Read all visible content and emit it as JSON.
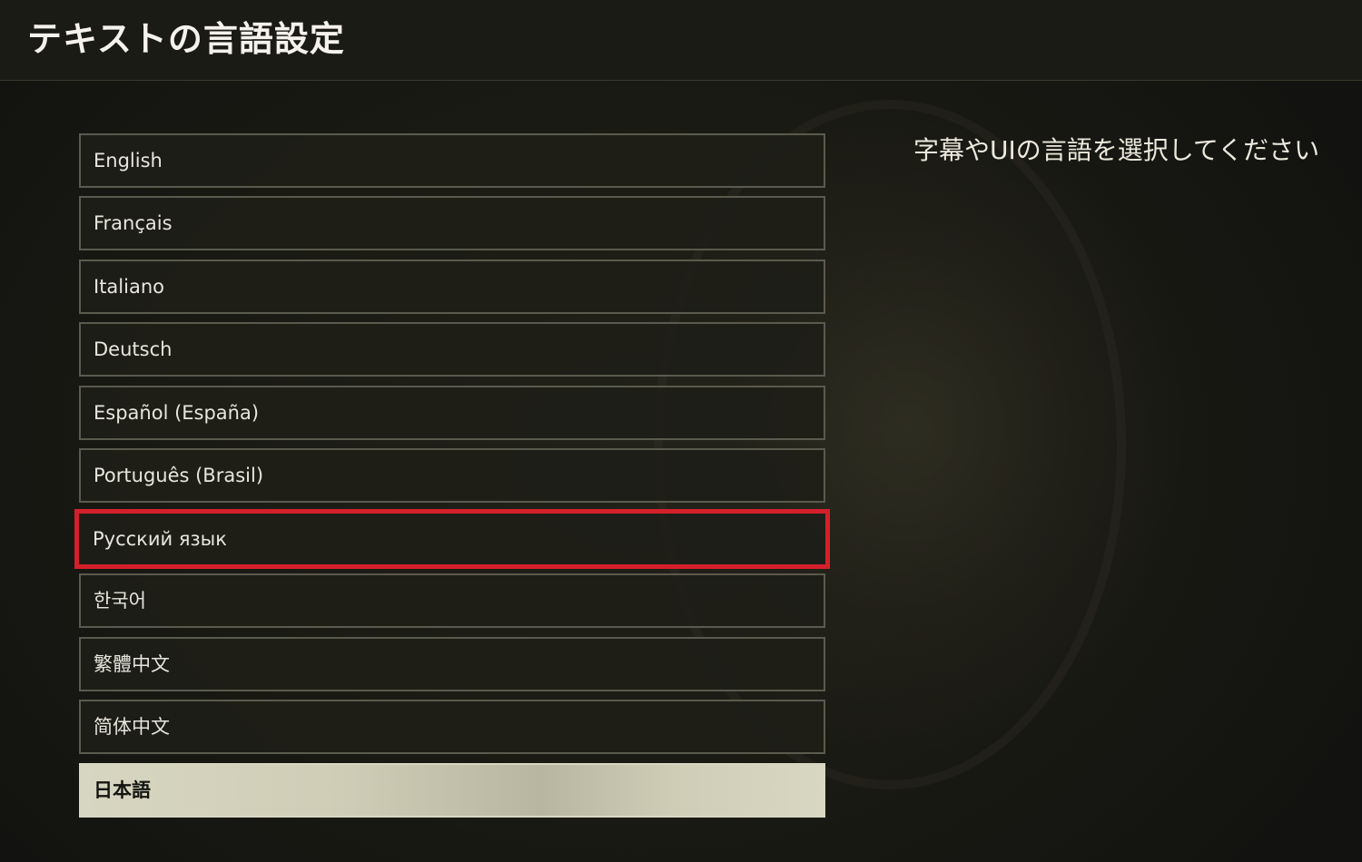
{
  "header": {
    "title": "テキストの言語設定"
  },
  "instruction": "字幕やUIの言語を選択してください",
  "languages": [
    {
      "label": "English"
    },
    {
      "label": "Français"
    },
    {
      "label": "Italiano"
    },
    {
      "label": "Deutsch"
    },
    {
      "label": "Español (España)"
    },
    {
      "label": "Português (Brasil)"
    },
    {
      "label": "Русский язык"
    },
    {
      "label": "한국어"
    },
    {
      "label": "繁體中文"
    },
    {
      "label": "简体中文"
    },
    {
      "label": "日本語"
    }
  ],
  "colors": {
    "highlight_border": "#d4202a",
    "selected_background": "#d7d6c0",
    "background": "#151510"
  }
}
